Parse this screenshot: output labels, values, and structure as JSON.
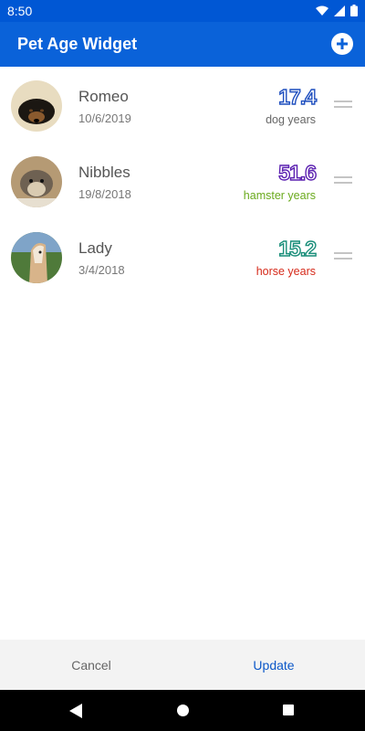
{
  "status_bar": {
    "time": "8:50"
  },
  "app_bar": {
    "title": "Pet Age Widget"
  },
  "pets": [
    {
      "name": "Romeo",
      "date": "10/6/2019",
      "age": "17.4",
      "unit": "dog years",
      "accent": "#1f4fbf",
      "unit_color": "#666666"
    },
    {
      "name": "Nibbles",
      "date": "19/8/2018",
      "age": "51.6",
      "unit": "hamster years",
      "accent": "#5a1fb0",
      "unit_color": "#6aaa1d"
    },
    {
      "name": "Lady",
      "date": "3/4/2018",
      "age": "15.2",
      "unit": "horse years",
      "accent": "#1a8e7a",
      "unit_color": "#d62a1a"
    }
  ],
  "actions": {
    "cancel_label": "Cancel",
    "update_label": "Update"
  },
  "colors": {
    "primary": "#0a62d9",
    "status_bar": "#0057d4",
    "update": "#0b57c8"
  },
  "icons": [
    "wifi-icon",
    "signal-icon",
    "battery-icon",
    "add-icon",
    "drag-handle-icon",
    "back-icon",
    "home-icon",
    "recents-icon"
  ]
}
